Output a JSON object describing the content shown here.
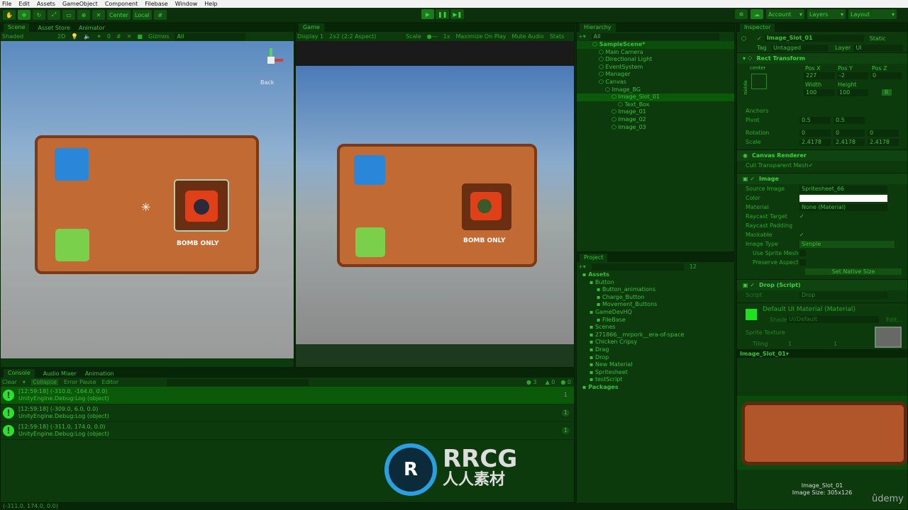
{
  "menu": [
    "File",
    "Edit",
    "Assets",
    "GameObject",
    "Component",
    "Filebase",
    "Window",
    "Help"
  ],
  "toolbar": {
    "center": "Center",
    "local": "Local",
    "account": "Account",
    "layers": "Layers",
    "layout": "Layout"
  },
  "scene": {
    "tabs": [
      "Scene",
      "Asset Store",
      "Animator"
    ],
    "shading": "Shaded",
    "mode2d": "2D",
    "gizmos": "Gizmos",
    "search": "All",
    "hidden_count": "0",
    "back": "Back",
    "board_label": "BOMB ONLY"
  },
  "game": {
    "tab": "Game",
    "display": "Display 1",
    "aspect": "2x2 (2:2 Aspect)",
    "scale_label": "Scale",
    "scale": "1x",
    "maximize": "Maximize On Play",
    "mute": "Mute Audio",
    "stats": "Stats",
    "board_label": "BOMB ONLY"
  },
  "hierarchy": {
    "title": "Hierarchy",
    "search": "All",
    "items": [
      {
        "label": "SampleScene*",
        "depth": 0
      },
      {
        "label": "Main Camera",
        "depth": 1
      },
      {
        "label": "Directional Light",
        "depth": 1
      },
      {
        "label": "EventSystem",
        "depth": 1
      },
      {
        "label": "Manager",
        "depth": 1
      },
      {
        "label": "Canvas",
        "depth": 1
      },
      {
        "label": "Image_BG",
        "depth": 2
      },
      {
        "label": "Image_Slot_01",
        "depth": 3
      },
      {
        "label": "Text_Box",
        "depth": 4
      },
      {
        "label": "Image_01",
        "depth": 3
      },
      {
        "label": "Image_02",
        "depth": 3
      },
      {
        "label": "Image_03",
        "depth": 3
      }
    ]
  },
  "project": {
    "title": "Project",
    "hidden_count": "12",
    "items": [
      {
        "label": "Assets",
        "depth": 0
      },
      {
        "label": "Button",
        "depth": 1
      },
      {
        "label": "Button_animations",
        "depth": 2
      },
      {
        "label": "Charge_Button",
        "depth": 2
      },
      {
        "label": "Movement_Buttons",
        "depth": 2
      },
      {
        "label": "GameDevHQ",
        "depth": 1
      },
      {
        "label": "FileBase",
        "depth": 2
      },
      {
        "label": "Scenes",
        "depth": 1
      },
      {
        "label": "271866__mrpork__era-of-space",
        "depth": 1
      },
      {
        "label": "Chicken Cripsy",
        "depth": 1
      },
      {
        "label": "Drag",
        "depth": 1
      },
      {
        "label": "Drop",
        "depth": 1
      },
      {
        "label": "New Material",
        "depth": 1
      },
      {
        "label": "Spritesheet",
        "depth": 1
      },
      {
        "label": "testScript",
        "depth": 1
      },
      {
        "label": "Packages",
        "depth": 0
      }
    ]
  },
  "inspector": {
    "title": "Inspector",
    "object_name": "Image_Slot_01",
    "static": "Static",
    "tag_label": "Tag",
    "tag": "Untagged",
    "layer_label": "Layer",
    "layer": "UI",
    "rect": {
      "title": "Rect Transform",
      "anchor_h": "center",
      "anchor_v": "middle",
      "pos_x_label": "Pos X",
      "pos_y_label": "Pos Y",
      "pos_z_label": "Pos Z",
      "pos_x": "227",
      "pos_y": "-2",
      "pos_z": "0",
      "width_label": "Width",
      "height_label": "Height",
      "width": "100",
      "height": "100",
      "anchors": "Anchors",
      "pivot": "Pivot",
      "pivot_x": "0.5",
      "pivot_y": "0.5",
      "rotation": "Rotation",
      "rot_x": "0",
      "rot_y": "0",
      "rot_z": "0",
      "scale": "Scale",
      "scale_x": "2.4178",
      "scale_y": "2.4178",
      "scale_z": "2.4178",
      "btn_r": "R"
    },
    "canvas_renderer": {
      "title": "Canvas Renderer",
      "cull": "Cull Transparent Mesh"
    },
    "image": {
      "title": "Image",
      "source_label": "Source Image",
      "source": "Spritesheet_66",
      "color_label": "Color",
      "color": "#ffffff",
      "material_label": "Material",
      "material": "None (Material)",
      "raycast_target": "Raycast Target",
      "raycast_padding": "Raycast Padding",
      "maskable": "Maskable",
      "image_type_label": "Image Type",
      "image_type": "Simple",
      "use_sprite_mesh": "Use Sprite Mesh",
      "preserve_aspect": "Preserve Aspect",
      "set_native": "Set Native Size"
    },
    "drop": {
      "title": "Drop (Script)",
      "script_label": "Script",
      "script": "Drop"
    },
    "material": {
      "title": "Default UI Material (Material)",
      "shader_label": "Shader",
      "shader": "UI/Default",
      "edit": "Edit...",
      "sprite_texture": "Sprite Texture",
      "tiling": "Tiling",
      "tiling_x": "1",
      "tiling_y": "1"
    },
    "preview": {
      "title": "Image_Slot_01",
      "name": "Image_Slot_01",
      "size": "Image Size: 305x126"
    }
  },
  "console": {
    "tabs": [
      "Console",
      "Audio Mixer",
      "Animation"
    ],
    "clear": "Clear",
    "collapse": "Collapse",
    "error_pause": "Error Pause",
    "editor": "Editor",
    "log_count": "3",
    "warn_count": "0",
    "error_count": "0",
    "logs": [
      {
        "line1": "[12:59:18] (-310.0, -164.0, 0.0)",
        "line2": "UnityEngine.Debug:Log (object)",
        "count": "1"
      },
      {
        "line1": "[12:59:18] (-309.0, 6.0, 0.0)",
        "line2": "UnityEngine.Debug:Log (object)",
        "count": "1"
      },
      {
        "line1": "[12:59:18] (-311.0, 174.0, 0.0)",
        "line2": "UnityEngine.Debug:Log (object)",
        "count": "1"
      }
    ]
  },
  "status": "(-311.0, 174.0, 0.0)",
  "watermark": {
    "brand": "RRCG",
    "sub": "人人素材",
    "udemy": "ûdemy"
  }
}
